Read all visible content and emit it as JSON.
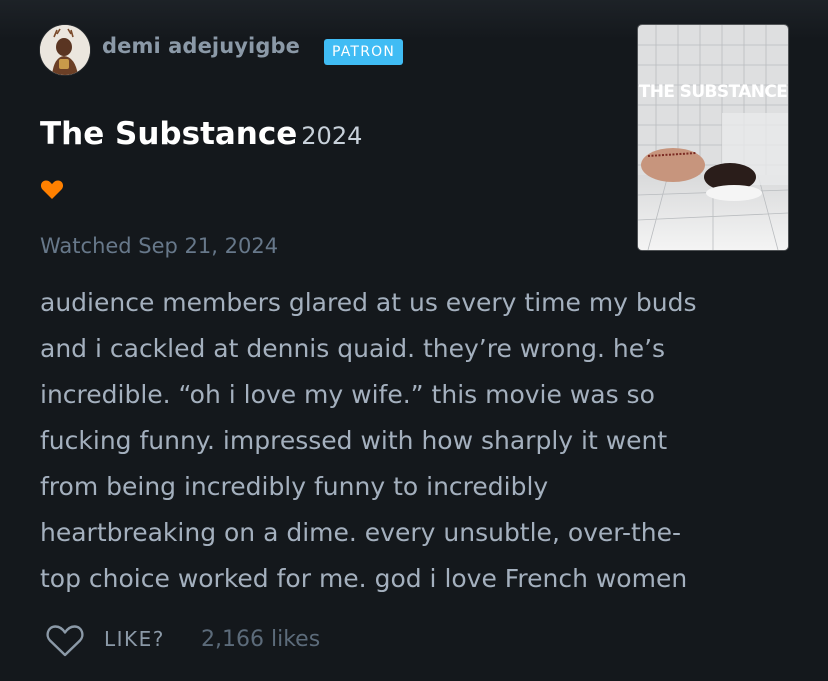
{
  "author": {
    "name": "demi adejuyigbe",
    "badge": "PATRON"
  },
  "film": {
    "title": "The Substance",
    "year": "2024",
    "poster_text": "THE SUBSTANCE"
  },
  "rating": {
    "liked": true,
    "icon": "heart-icon"
  },
  "watched_text": "Watched Sep 21, 2024",
  "review_lines": [
    "audience members glared at us every time my buds",
    "and i cackled at dennis quaid. they’re wrong. he’s",
    "incredible. “oh i love my wife.” this movie was so",
    "fucking funny. impressed with how sharply it went",
    "from being incredibly funny to incredibly",
    "heartbreaking on a dime. every unsubtle, over-the-",
    "top choice worked for me. god i love French women"
  ],
  "like": {
    "label": "LIKE?",
    "count": "2,166 likes"
  },
  "colors": {
    "background": "#14181c",
    "badge": "#40bcf4",
    "liked_heart": "#ff8000",
    "muted_text": "#67788a"
  }
}
